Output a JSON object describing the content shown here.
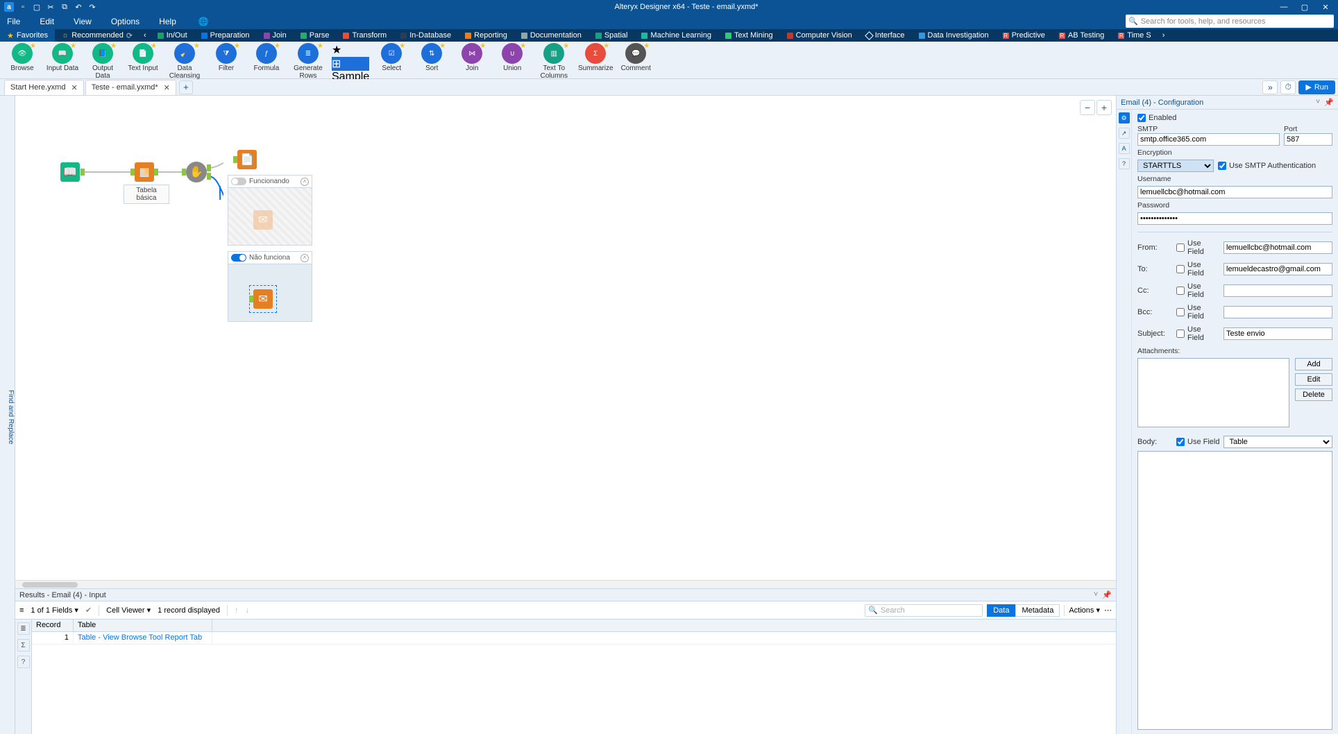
{
  "titlebar": {
    "app_icon_letter": "a",
    "title": "Alteryx Designer x64 - Teste - email.yxmd*"
  },
  "menu": {
    "items": [
      "File",
      "Edit",
      "View",
      "Options",
      "Help"
    ],
    "search_placeholder": "Search for tools, help, and resources"
  },
  "categories": [
    {
      "label": "Favorites",
      "color": "#f5c518",
      "fav": true
    },
    {
      "label": "Recommended",
      "color": "#f5a623",
      "extra": "☼ ⟳"
    },
    {
      "label": "In/Out",
      "color": "#1aa260"
    },
    {
      "label": "Preparation",
      "color": "#0b74de"
    },
    {
      "label": "Join",
      "color": "#8e44ad"
    },
    {
      "label": "Parse",
      "color": "#27ae60"
    },
    {
      "label": "Transform",
      "color": "#e74c3c"
    },
    {
      "label": "In-Database",
      "color": "#2c3e50"
    },
    {
      "label": "Reporting",
      "color": "#e67e22"
    },
    {
      "label": "Documentation",
      "color": "#95a5a6"
    },
    {
      "label": "Spatial",
      "color": "#16a085"
    },
    {
      "label": "Machine Learning",
      "color": "#1abc9c"
    },
    {
      "label": "Text Mining",
      "color": "#2ecc71"
    },
    {
      "label": "Computer Vision",
      "color": "#c0392b"
    },
    {
      "label": "Interface",
      "color": "#7f8c8d"
    },
    {
      "label": "Data Investigation",
      "color": "#3498db"
    },
    {
      "label": "Predictive",
      "color": "#e74c3c",
      "badge": "R"
    },
    {
      "label": "AB Testing",
      "color": "#e74c3c",
      "badge": "R"
    },
    {
      "label": "Time S",
      "color": "#e74c3c",
      "badge": "R"
    }
  ],
  "tools": [
    {
      "label": "Browse",
      "color": "#12b886"
    },
    {
      "label": "Input Data",
      "color": "#12b886"
    },
    {
      "label": "Output Data",
      "color": "#12b886"
    },
    {
      "label": "Text Input",
      "color": "#12b886"
    },
    {
      "label": "Data Cleansing",
      "color": "#1e6fd9"
    },
    {
      "label": "Filter",
      "color": "#1e6fd9"
    },
    {
      "label": "Formula",
      "color": "#1e6fd9"
    },
    {
      "label": "Generate Rows",
      "color": "#1e6fd9"
    },
    {
      "label": "Sample",
      "color": "#1e6fd9"
    },
    {
      "label": "Select",
      "color": "#1e6fd9"
    },
    {
      "label": "Sort",
      "color": "#1e6fd9"
    },
    {
      "label": "Join",
      "color": "#8e44ad"
    },
    {
      "label": "Union",
      "color": "#8e44ad"
    },
    {
      "label": "Text To Columns",
      "color": "#16a085"
    },
    {
      "label": "Summarize",
      "color": "#e74c3c"
    },
    {
      "label": "Comment",
      "color": "#666"
    }
  ],
  "tabs": {
    "items": [
      {
        "label": "Start Here.yxmd"
      },
      {
        "label": "Teste - email.yxmd*"
      }
    ],
    "run_label": "Run"
  },
  "left_rail_label": "Find and Replace",
  "canvas": {
    "label_table": "Tabela básica",
    "container1": "Funcionando",
    "container2": "Não funciona"
  },
  "results": {
    "header": "Results - Email (4) - Input",
    "fields_summary": "1 of 1 Fields",
    "cell_viewer": "Cell Viewer",
    "record_count": "1 record displayed",
    "search_placeholder": "Search",
    "tab_data": "Data",
    "tab_metadata": "Metadata",
    "actions_label": "Actions",
    "columns": [
      "Record",
      "Table"
    ],
    "rows": [
      {
        "record": "1",
        "table": "Table - View Browse Tool Report Tab"
      }
    ]
  },
  "config": {
    "title": "Email (4) - Configuration",
    "enabled_label": "Enabled",
    "smtp_label": "SMTP",
    "smtp_value": "smtp.office365.com",
    "port_label": "Port",
    "port_value": "587",
    "encryption_label": "Encryption",
    "encryption_value": "STARTTLS",
    "use_smtp_auth_label": "Use SMTP Authentication",
    "username_label": "Username",
    "username_value": "lemuellcbc@hotmail.com",
    "password_label": "Password",
    "password_value": "••••••••••••••",
    "from_label": "From:",
    "from_value": "lemuellcbc@hotmail.com",
    "to_label": "To:",
    "to_value": "lemueldecastro@gmail.com",
    "cc_label": "Cc:",
    "bcc_label": "Bcc:",
    "subject_label": "Subject:",
    "subject_value": "Teste envio",
    "use_field_label": "Use Field",
    "attachments_label": "Attachments:",
    "btn_add": "Add",
    "btn_edit": "Edit",
    "btn_delete": "Delete",
    "body_label": "Body:",
    "body_use_field_checked": true,
    "body_select_value": "Table"
  }
}
